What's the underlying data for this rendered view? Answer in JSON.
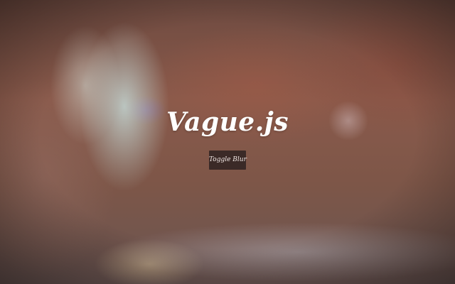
{
  "app": {
    "title": "Vague.js",
    "toggle_button_label": "Toggle Blur"
  },
  "colors": {
    "button_bg": "#3b2a27",
    "title_color": "#ffffff"
  }
}
